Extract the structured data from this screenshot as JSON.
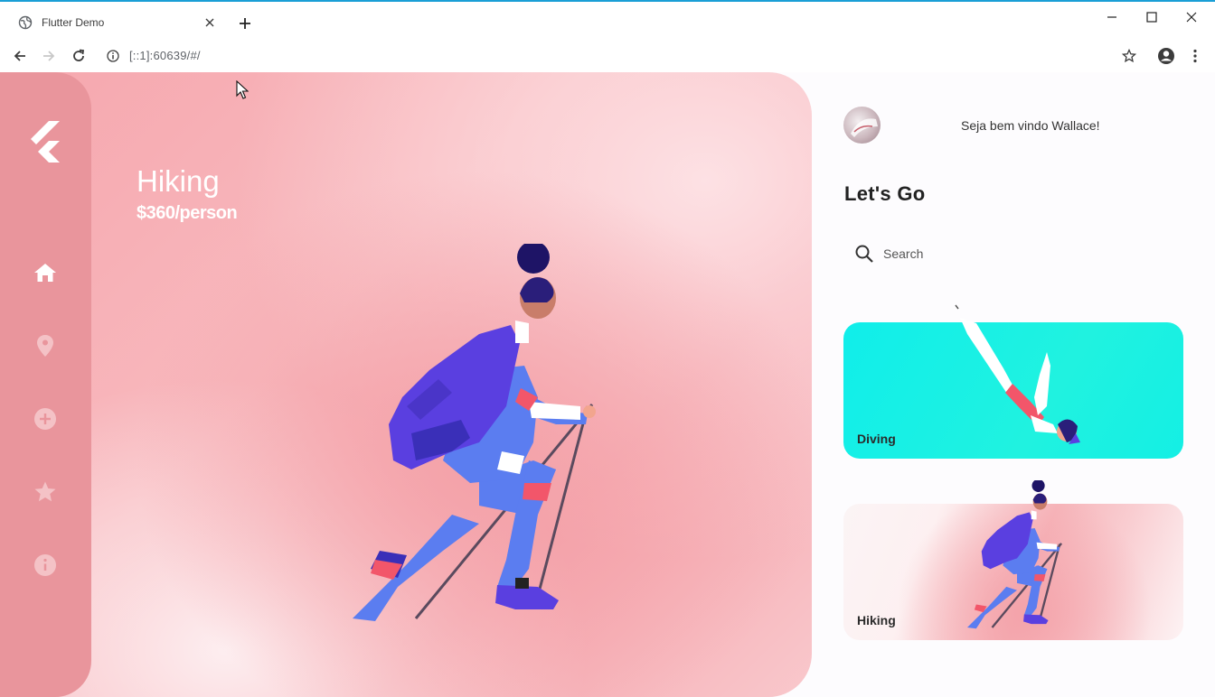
{
  "browser": {
    "tab_title": "Flutter Demo",
    "url": "[::1]:60639/#/"
  },
  "sidebar": {
    "items": [
      {
        "icon": "home-icon",
        "active": true
      },
      {
        "icon": "location-pin-icon",
        "active": false
      },
      {
        "icon": "add-circle-icon",
        "active": false
      },
      {
        "icon": "star-icon",
        "active": false
      },
      {
        "icon": "info-icon",
        "active": false
      }
    ]
  },
  "hero": {
    "title": "Hiking",
    "price": "$360/person"
  },
  "panel": {
    "welcome": "Seja bem vindo Wallace!",
    "heading": "Let's Go",
    "search_placeholder": "Search",
    "cards": [
      {
        "label": "Diving",
        "color": "#14f0e8"
      },
      {
        "label": "Hiking",
        "color": "#f6b5ba"
      }
    ]
  },
  "colors": {
    "sidebar": "#e9959c",
    "hero_bg": "#f6a7ae",
    "accent_blue": "#5b7df0",
    "backpack": "#5a3fe0"
  }
}
